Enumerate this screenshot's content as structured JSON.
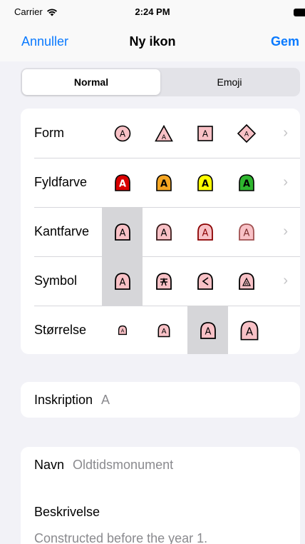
{
  "status": {
    "carrier": "Carrier",
    "time": "2:24 PM"
  },
  "nav": {
    "cancel": "Annuller",
    "title": "Ny ikon",
    "save": "Gem"
  },
  "segments": {
    "normal": "Normal",
    "emoji": "Emoji",
    "selected": "Normal"
  },
  "rows": {
    "form": {
      "label": "Form"
    },
    "fill": {
      "label": "Fyldfarve"
    },
    "border": {
      "label": "Kantfarve"
    },
    "symbol": {
      "label": "Symbol"
    },
    "size": {
      "label": "Størrelse"
    }
  },
  "icon_letter": "A",
  "fill_colors": [
    "#d90000",
    "#f5a623",
    "#ffff00",
    "#2fb52f"
  ],
  "border_colors": [
    "#000000",
    "#8b0000",
    "#c0303a",
    "#a05050"
  ],
  "icon_fill": "#f8c1c6",
  "inscription": {
    "label": "Inskription",
    "value": "A"
  },
  "name": {
    "label": "Navn",
    "value": "Oldtidsmonument"
  },
  "description": {
    "label": "Beskrivelse",
    "value": "Constructed before the year 1."
  }
}
